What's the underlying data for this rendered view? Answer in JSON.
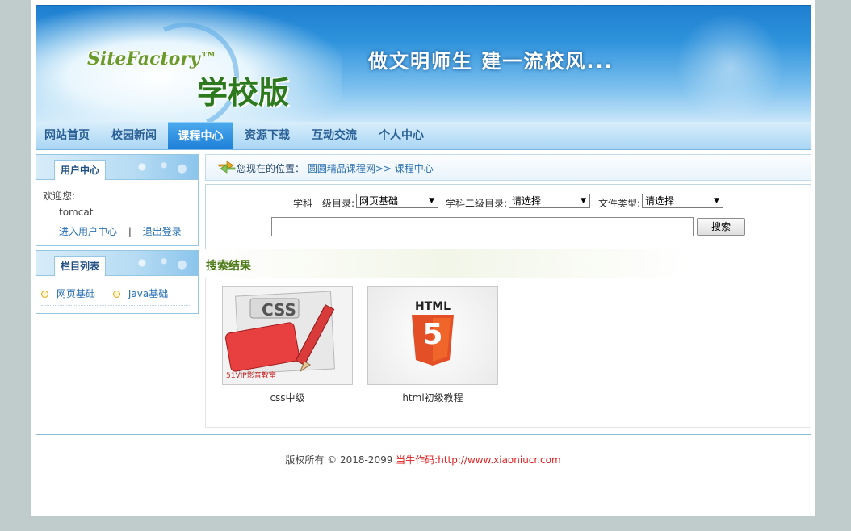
{
  "banner": {
    "brand": "SiteFactory™",
    "edition": "学校版",
    "slogan": "做文明师生  建一流校风..."
  },
  "nav": {
    "items": [
      {
        "label": "网站首页"
      },
      {
        "label": "校园新闻"
      },
      {
        "label": "课程中心",
        "active": true
      },
      {
        "label": "资源下载"
      },
      {
        "label": "互动交流"
      },
      {
        "label": "个人中心"
      }
    ]
  },
  "user_box": {
    "title": "用户中心",
    "welcome": "欢迎您:",
    "username": "tomcat",
    "link_center": "进入用户中心",
    "separator": "|",
    "link_logout": "退出登录"
  },
  "category_box": {
    "title": "栏目列表",
    "items": [
      {
        "label": "网页基础"
      },
      {
        "label": "Java基础"
      }
    ]
  },
  "breadcrumb": {
    "prefix": "您现在的位置：",
    "path": "圆圆精品课程网>> 课程中心"
  },
  "search": {
    "subject1_label": "学科一级目录:",
    "subject1_value": "网页基础",
    "subject2_label": "学科二级目录:",
    "subject2_value": "请选择",
    "filetype_label": "文件类型:",
    "filetype_value": "请选择",
    "keyword_value": "",
    "button_label": "搜索"
  },
  "results": {
    "title": "搜索结果",
    "courses": [
      {
        "name": "css中级",
        "thumb_text": "CSS",
        "watermark": "51VIP影音教室"
      },
      {
        "name": "html初级教程",
        "thumb_text": "HTML",
        "badge": "5"
      }
    ]
  },
  "footer": {
    "copyright": "版权所有 © 2018-2099 ",
    "author": "当牛作码:http://www.xiaoniucr.com"
  },
  "colors": {
    "nav_active": "#1d7fd8",
    "link": "#2b72b5",
    "results_title": "#4d7a17",
    "footer_highlight": "#e02020",
    "html5_orange": "#e34f26"
  }
}
